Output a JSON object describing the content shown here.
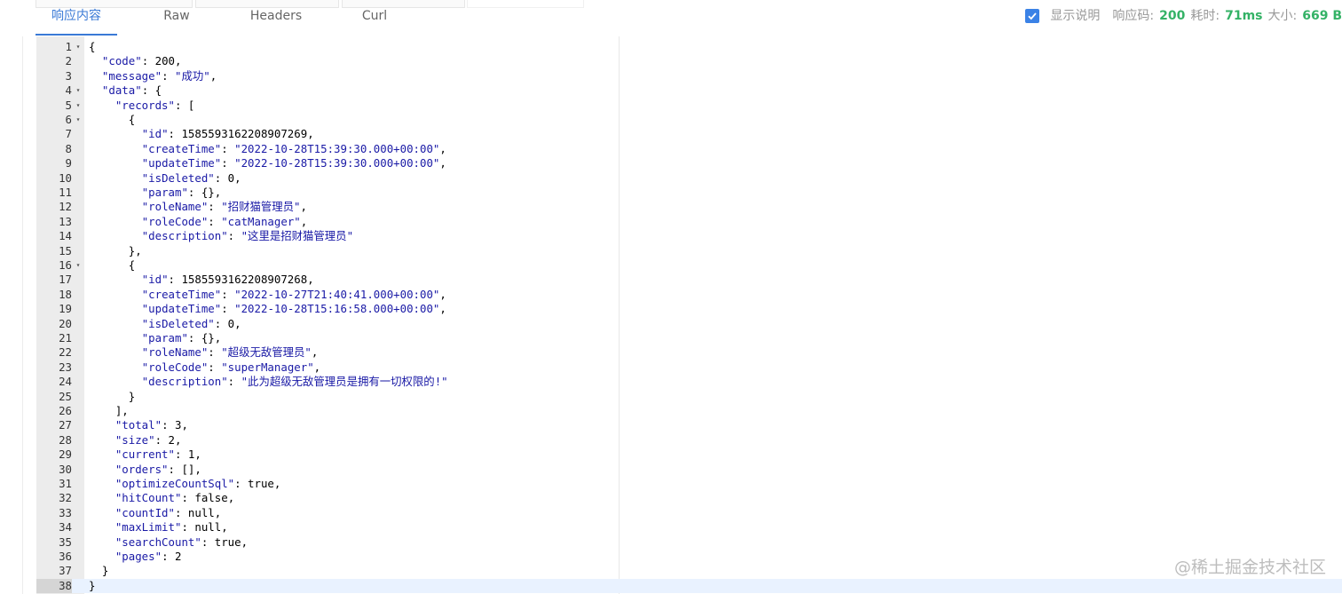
{
  "tabs": [
    {
      "label": "响应内容",
      "active": true
    },
    {
      "label": "Raw",
      "active": false
    },
    {
      "label": "Headers",
      "active": false
    },
    {
      "label": "Curl",
      "active": false
    }
  ],
  "status": {
    "show_desc_checked": true,
    "show_desc_label": "显示说明",
    "code_label": "响应码:",
    "code_value": "200",
    "time_label": "耗时:",
    "time_value": "71ms",
    "size_label": "大小:",
    "size_value": "669 B"
  },
  "editor": {
    "current_line": 38,
    "lines": [
      {
        "n": "1",
        "fold": true,
        "text": "{"
      },
      {
        "n": "2",
        "text": "  \"code\": 200,"
      },
      {
        "n": "3",
        "text": "  \"message\": \"成功\","
      },
      {
        "n": "4",
        "fold": true,
        "text": "  \"data\": {"
      },
      {
        "n": "5",
        "fold": true,
        "text": "    \"records\": ["
      },
      {
        "n": "6",
        "fold": true,
        "text": "      {"
      },
      {
        "n": "7",
        "text": "        \"id\": 1585593162208907269,"
      },
      {
        "n": "8",
        "text": "        \"createTime\": \"2022-10-28T15:39:30.000+00:00\","
      },
      {
        "n": "9",
        "text": "        \"updateTime\": \"2022-10-28T15:39:30.000+00:00\","
      },
      {
        "n": "10",
        "text": "        \"isDeleted\": 0,"
      },
      {
        "n": "11",
        "text": "        \"param\": {},"
      },
      {
        "n": "12",
        "text": "        \"roleName\": \"招财猫管理员\","
      },
      {
        "n": "13",
        "text": "        \"roleCode\": \"catManager\","
      },
      {
        "n": "14",
        "text": "        \"description\": \"这里是招财猫管理员\""
      },
      {
        "n": "15",
        "text": "      },"
      },
      {
        "n": "16",
        "fold": true,
        "text": "      {"
      },
      {
        "n": "17",
        "text": "        \"id\": 1585593162208907268,"
      },
      {
        "n": "18",
        "text": "        \"createTime\": \"2022-10-27T21:40:41.000+00:00\","
      },
      {
        "n": "19",
        "text": "        \"updateTime\": \"2022-10-28T15:16:58.000+00:00\","
      },
      {
        "n": "20",
        "text": "        \"isDeleted\": 0,"
      },
      {
        "n": "21",
        "text": "        \"param\": {},"
      },
      {
        "n": "22",
        "text": "        \"roleName\": \"超级无敌管理员\","
      },
      {
        "n": "23",
        "text": "        \"roleCode\": \"superManager\","
      },
      {
        "n": "24",
        "text": "        \"description\": \"此为超级无敌管理员是拥有一切权限的!\""
      },
      {
        "n": "25",
        "text": "      }"
      },
      {
        "n": "26",
        "text": "    ],"
      },
      {
        "n": "27",
        "text": "    \"total\": 3,"
      },
      {
        "n": "28",
        "text": "    \"size\": 2,"
      },
      {
        "n": "29",
        "text": "    \"current\": 1,"
      },
      {
        "n": "30",
        "text": "    \"orders\": [],"
      },
      {
        "n": "31",
        "text": "    \"optimizeCountSql\": true,"
      },
      {
        "n": "32",
        "text": "    \"hitCount\": false,"
      },
      {
        "n": "33",
        "text": "    \"countId\": null,"
      },
      {
        "n": "34",
        "text": "    \"maxLimit\": null,"
      },
      {
        "n": "35",
        "text": "    \"searchCount\": true,"
      },
      {
        "n": "36",
        "text": "    \"pages\": 2"
      },
      {
        "n": "37",
        "text": "  }"
      },
      {
        "n": "38",
        "text": "}"
      }
    ]
  },
  "watermark": "@稀土掘金技术社区"
}
